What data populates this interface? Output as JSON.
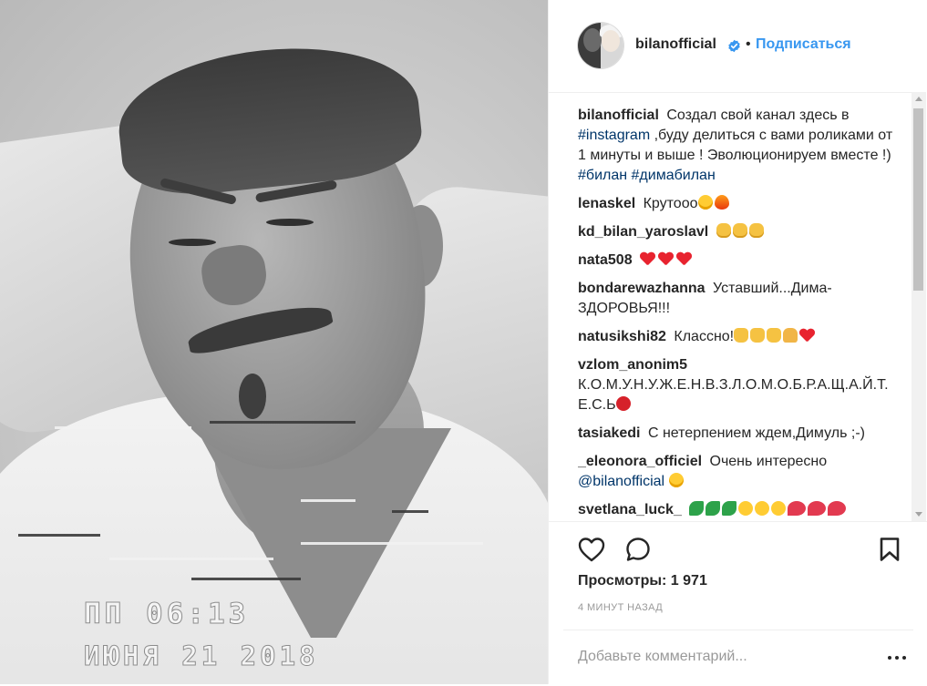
{
  "post": {
    "media": {
      "overlay_time": "ПП 06:13",
      "overlay_date": "ИЮНЯ 21 2018"
    },
    "header": {
      "username": "bilanofficial",
      "separator": "•",
      "follow_label": "Подписаться",
      "verified_icon": "verified-badge-icon",
      "accent_color": "#3897f0"
    },
    "caption": {
      "username": "bilanofficial",
      "text_1": "Создал свой канал здесь в",
      "tag_1": "#instagram",
      "text_2": ",буду делиться с вами роликами от 1 минуты и выше ! Эволюционируем вместе !)",
      "tag_2": "#билан",
      "tag_3": "#димабилан"
    },
    "comments": [
      {
        "username": "lenaskel",
        "text": "Крутооо"
      },
      {
        "username": "kd_bilan_yaroslavl",
        "text": ""
      },
      {
        "username": "nata508",
        "text": ""
      },
      {
        "username": "bondarewazhanna",
        "text": "Уставший...Дима-ЗДОРОВЬЯ!!!"
      },
      {
        "username": "natusikshi82",
        "text": "Классно!"
      },
      {
        "username": "vzlom_anonim5",
        "text": "К.О.М.У.Н.У.Ж.Е.Н.В.З.Л.О.М.О.Б.Р.А.Щ.А.Й.Т.Е.С.Ь"
      },
      {
        "username": "tasiakedi",
        "text": "С нетерпением ждем,Димуль ;-)"
      },
      {
        "username": "_eleonora_officiel",
        "text": "Очень интересно",
        "mention": "@bilanofficial"
      },
      {
        "username": "svetlana_luck_",
        "text": ""
      }
    ],
    "actions": {
      "views_label": "Просмотры:",
      "views_value": "1 971",
      "timestamp": "4 минут назад",
      "comment_placeholder": "Добавьте комментарий..."
    },
    "icons": {
      "like": "heart-outline-icon",
      "comment": "speech-bubble-icon",
      "save": "bookmark-icon",
      "more": "ellipsis-icon"
    }
  }
}
